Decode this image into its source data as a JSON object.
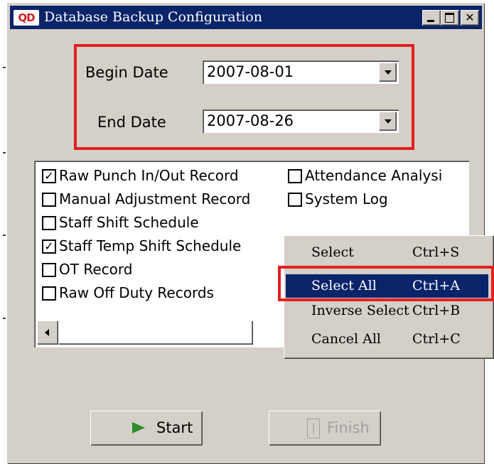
{
  "window": {
    "title": "Database Backup Configuration",
    "icon_text": "QD",
    "controls": [
      "minimize",
      "maximize",
      "close"
    ],
    "close_glyph": "✕"
  },
  "dates": {
    "begin_label": "Begin Date",
    "begin_value": "2007-08-01",
    "end_label": "End Date",
    "end_value": "2007-08-26"
  },
  "records": {
    "items": [
      {
        "label": "Raw Punch In/Out Record",
        "checked": true
      },
      {
        "label": "Attendance Analysi",
        "checked": false
      },
      {
        "label": "Manual Adjustment Record",
        "checked": false
      },
      {
        "label": "System Log",
        "checked": false
      },
      {
        "label": "Staff Shift Schedule",
        "checked": false
      },
      {
        "label": "Staff Temp Shift Schedule",
        "checked": true
      },
      {
        "label": "OT Record",
        "checked": false
      },
      {
        "label": "Raw Off Duty Records",
        "checked": false
      }
    ],
    "check_glyph": "✓"
  },
  "context_menu": {
    "items": [
      {
        "label": "Select",
        "shortcut": "Ctrl+S",
        "highlighted": false
      },
      {
        "label": "Select All",
        "shortcut": "Ctrl+A",
        "highlighted": true
      },
      {
        "label": "Inverse Select",
        "shortcut": "Ctrl+B",
        "highlighted": false
      },
      {
        "label": "Cancel All",
        "shortcut": "Ctrl+C",
        "highlighted": false
      }
    ]
  },
  "buttons": {
    "start_label": "Start",
    "finish_label": "Finish",
    "finish_enabled": false
  },
  "colors": {
    "titlebar": "#0a246a",
    "highlight_box": "#e32020",
    "start_icon": "#2e8b2e"
  }
}
